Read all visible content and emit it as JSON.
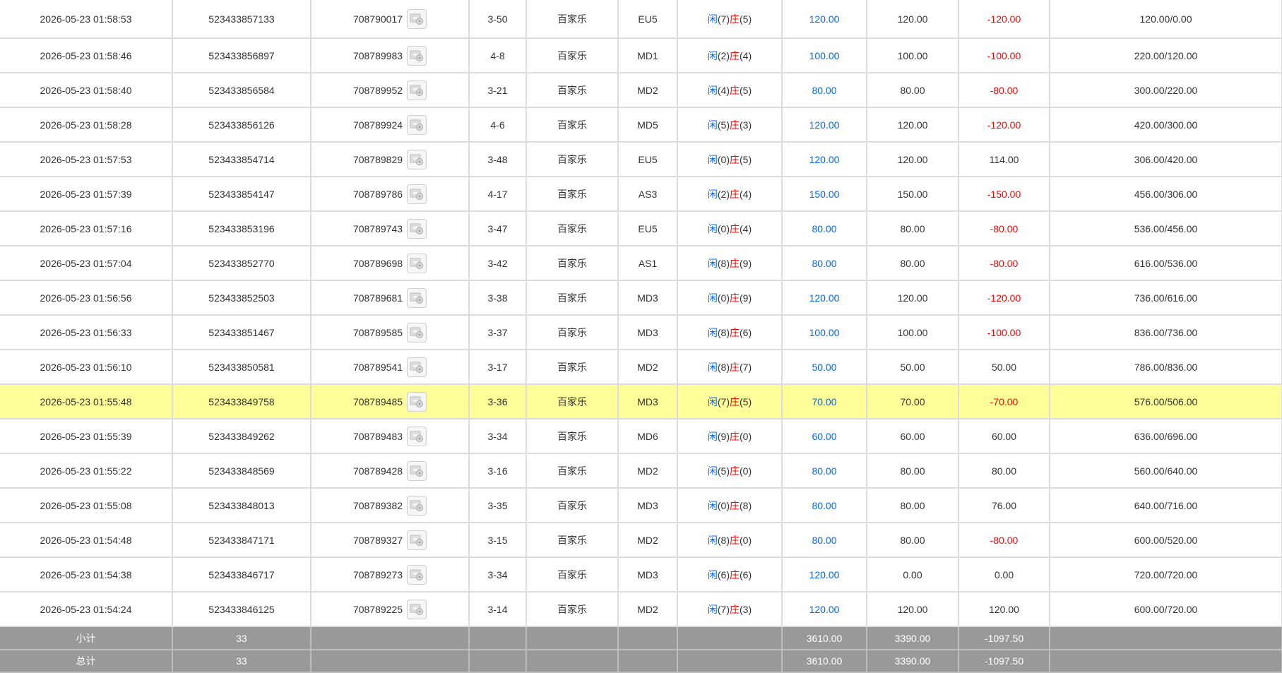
{
  "colors": {
    "player": "#0066ff",
    "banker": "#ff0000",
    "highlight": "#ffff99",
    "summary_bg": "#999999"
  },
  "rows": [
    {
      "time": "2026-05-23 01:58:53",
      "order_no": "523433857133",
      "round_no": "708790017",
      "table": "3-50",
      "game": "百家乐",
      "room": "EU5",
      "p_label": "闲",
      "p_val": "(7)",
      "b_label": "庄",
      "b_val": "(5)",
      "bet": "120.00",
      "valid": "120.00",
      "win": "-120.00",
      "win_neg": true,
      "balance": "120.00/0.00",
      "icon": "replay-icon"
    },
    {
      "time": "2026-05-23 01:58:46",
      "order_no": "523433856897",
      "round_no": "708789983",
      "table": "4-8",
      "game": "百家乐",
      "room": "MD1",
      "p_label": "闲",
      "p_val": "(2)",
      "b_label": "庄",
      "b_val": "(4)",
      "bet": "100.00",
      "valid": "100.00",
      "win": "-100.00",
      "win_neg": true,
      "balance": "220.00/120.00",
      "icon": "replay-icon"
    },
    {
      "time": "2026-05-23 01:58:40",
      "order_no": "523433856584",
      "round_no": "708789952",
      "table": "3-21",
      "game": "百家乐",
      "room": "MD2",
      "p_label": "闲",
      "p_val": "(4)",
      "b_label": "庄",
      "b_val": "(5)",
      "bet": "80.00",
      "valid": "80.00",
      "win": "-80.00",
      "win_neg": true,
      "balance": "300.00/220.00",
      "icon": "replay-icon"
    },
    {
      "time": "2026-05-23 01:58:28",
      "order_no": "523433856126",
      "round_no": "708789924",
      "table": "4-6",
      "game": "百家乐",
      "room": "MD5",
      "p_label": "闲",
      "p_val": "(5)",
      "b_label": "庄",
      "b_val": "(3)",
      "bet": "120.00",
      "valid": "120.00",
      "win": "-120.00",
      "win_neg": true,
      "balance": "420.00/300.00",
      "icon": "replay-icon"
    },
    {
      "time": "2026-05-23 01:57:53",
      "order_no": "523433854714",
      "round_no": "708789829",
      "table": "3-48",
      "game": "百家乐",
      "room": "EU5",
      "p_label": "闲",
      "p_val": "(0)",
      "b_label": "庄",
      "b_val": "(5)",
      "bet": "120.00",
      "valid": "120.00",
      "win": "114.00",
      "win_neg": false,
      "balance": "306.00/420.00",
      "icon": "replay-icon"
    },
    {
      "time": "2026-05-23 01:57:39",
      "order_no": "523433854147",
      "round_no": "708789786",
      "table": "4-17",
      "game": "百家乐",
      "room": "AS3",
      "p_label": "闲",
      "p_val": "(2)",
      "b_label": "庄",
      "b_val": "(4)",
      "bet": "150.00",
      "valid": "150.00",
      "win": "-150.00",
      "win_neg": true,
      "balance": "456.00/306.00",
      "icon": "replay-icon"
    },
    {
      "time": "2026-05-23 01:57:16",
      "order_no": "523433853196",
      "round_no": "708789743",
      "table": "3-47",
      "game": "百家乐",
      "room": "EU5",
      "p_label": "闲",
      "p_val": "(0)",
      "b_label": "庄",
      "b_val": "(4)",
      "bet": "80.00",
      "valid": "80.00",
      "win": "-80.00",
      "win_neg": true,
      "balance": "536.00/456.00",
      "icon": "replay-icon"
    },
    {
      "time": "2026-05-23 01:57:04",
      "order_no": "523433852770",
      "round_no": "708789698",
      "table": "3-42",
      "game": "百家乐",
      "room": "AS1",
      "p_label": "闲",
      "p_val": "(8)",
      "b_label": "庄",
      "b_val": "(9)",
      "bet": "80.00",
      "valid": "80.00",
      "win": "-80.00",
      "win_neg": true,
      "balance": "616.00/536.00",
      "icon": "replay-icon"
    },
    {
      "time": "2026-05-23 01:56:56",
      "order_no": "523433852503",
      "round_no": "708789681",
      "table": "3-38",
      "game": "百家乐",
      "room": "MD3",
      "p_label": "闲",
      "p_val": "(0)",
      "b_label": "庄",
      "b_val": "(9)",
      "bet": "120.00",
      "valid": "120.00",
      "win": "-120.00",
      "win_neg": true,
      "balance": "736.00/616.00",
      "icon": "replay-icon"
    },
    {
      "time": "2026-05-23 01:56:33",
      "order_no": "523433851467",
      "round_no": "708789585",
      "table": "3-37",
      "game": "百家乐",
      "room": "MD3",
      "p_label": "闲",
      "p_val": "(8)",
      "b_label": "庄",
      "b_val": "(6)",
      "bet": "100.00",
      "valid": "100.00",
      "win": "-100.00",
      "win_neg": true,
      "balance": "836.00/736.00",
      "icon": "replay-icon"
    },
    {
      "time": "2026-05-23 01:56:10",
      "order_no": "523433850581",
      "round_no": "708789541",
      "table": "3-17",
      "game": "百家乐",
      "room": "MD2",
      "p_label": "闲",
      "p_val": "(8)",
      "b_label": "庄",
      "b_val": "(7)",
      "bet": "50.00",
      "valid": "50.00",
      "win": "50.00",
      "win_neg": false,
      "balance": "786.00/836.00",
      "icon": "replay-icon"
    },
    {
      "time": "2026-05-23 01:55:48",
      "order_no": "523433849758",
      "round_no": "708789485",
      "table": "3-36",
      "game": "百家乐",
      "room": "MD3",
      "p_label": "闲",
      "p_val": "(7)",
      "b_label": "庄",
      "b_val": "(5)",
      "bet": "70.00",
      "valid": "70.00",
      "win": "-70.00",
      "win_neg": true,
      "balance": "576.00/506.00",
      "icon": "replay-icon",
      "highlighted": true
    },
    {
      "time": "2026-05-23 01:55:39",
      "order_no": "523433849262",
      "round_no": "708789483",
      "table": "3-34",
      "game": "百家乐",
      "room": "MD6",
      "p_label": "闲",
      "p_val": "(9)",
      "b_label": "庄",
      "b_val": "(0)",
      "bet": "60.00",
      "valid": "60.00",
      "win": "60.00",
      "win_neg": false,
      "balance": "636.00/696.00",
      "icon": "replay-icon"
    },
    {
      "time": "2026-05-23 01:55:22",
      "order_no": "523433848569",
      "round_no": "708789428",
      "table": "3-16",
      "game": "百家乐",
      "room": "MD2",
      "p_label": "闲",
      "p_val": "(5)",
      "b_label": "庄",
      "b_val": "(0)",
      "bet": "80.00",
      "valid": "80.00",
      "win": "80.00",
      "win_neg": false,
      "balance": "560.00/640.00",
      "icon": "replay-icon"
    },
    {
      "time": "2026-05-23 01:55:08",
      "order_no": "523433848013",
      "round_no": "708789382",
      "table": "3-35",
      "game": "百家乐",
      "room": "MD3",
      "p_label": "闲",
      "p_val": "(0)",
      "b_label": "庄",
      "b_val": "(8)",
      "bet": "80.00",
      "valid": "80.00",
      "win": "76.00",
      "win_neg": false,
      "balance": "640.00/716.00",
      "icon": "replay-icon"
    },
    {
      "time": "2026-05-23 01:54:48",
      "order_no": "523433847171",
      "round_no": "708789327",
      "table": "3-15",
      "game": "百家乐",
      "room": "MD2",
      "p_label": "闲",
      "p_val": "(8)",
      "b_label": "庄",
      "b_val": "(0)",
      "bet": "80.00",
      "valid": "80.00",
      "win": "-80.00",
      "win_neg": true,
      "balance": "600.00/520.00",
      "icon": "replay-icon"
    },
    {
      "time": "2026-05-23 01:54:38",
      "order_no": "523433846717",
      "round_no": "708789273",
      "table": "3-34",
      "game": "百家乐",
      "room": "MD3",
      "p_label": "闲",
      "p_val": "(6)",
      "b_label": "庄",
      "b_val": "(6)",
      "bet": "120.00",
      "valid": "0.00",
      "win": "0.00",
      "win_neg": false,
      "balance": "720.00/720.00",
      "icon": "replay-icon"
    },
    {
      "time": "2026-05-23 01:54:24",
      "order_no": "523433846125",
      "round_no": "708789225",
      "table": "3-14",
      "game": "百家乐",
      "room": "MD2",
      "p_label": "闲",
      "p_val": "(7)",
      "b_label": "庄",
      "b_val": "(3)",
      "bet": "120.00",
      "valid": "120.00",
      "win": "120.00",
      "win_neg": false,
      "balance": "600.00/720.00",
      "icon": "replay-icon"
    }
  ],
  "subtotal": {
    "label": "小计",
    "count": "33",
    "bet": "3610.00",
    "valid": "3390.00",
    "win": "-1097.50"
  },
  "total": {
    "label": "总计",
    "count": "33",
    "bet": "3610.00",
    "valid": "3390.00",
    "win": "-1097.50"
  }
}
